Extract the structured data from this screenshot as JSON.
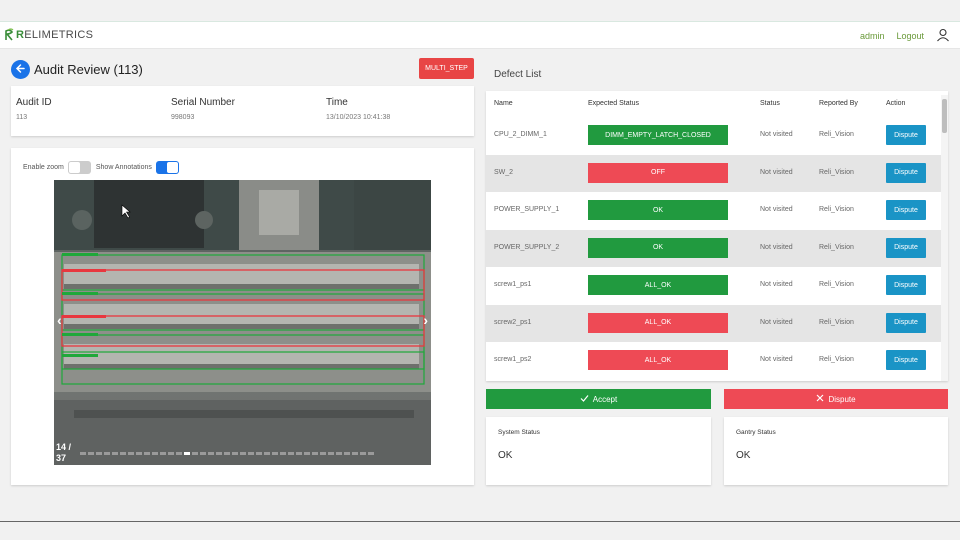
{
  "header": {
    "brand_initial": "R",
    "brand_rest": "ELIMETRICS",
    "user": "admin",
    "logout": "Logout"
  },
  "audit": {
    "title": "Audit Review (113)",
    "multi_step": "MULTI_STEP",
    "fields": [
      {
        "label": "Audit ID",
        "value": "113"
      },
      {
        "label": "Serial Number",
        "value": "998093"
      },
      {
        "label": "Time",
        "value": "13/10/2023 10:41:38"
      }
    ],
    "enable_zoom": "Enable zoom",
    "show_annotations": "Show Annotations",
    "zoom_enabled": false,
    "annotations_enabled": true,
    "counter_current": "14 /",
    "counter_total": "37",
    "current_index": 14,
    "total_images": 37
  },
  "defects": {
    "title": "Defect List",
    "columns": [
      "Name",
      "Expected Status",
      "Status",
      "Reported By",
      "Action"
    ],
    "rows": [
      {
        "name": "CPU_2_DIMM_1",
        "expected": "DIMM_EMPTY_LATCH_CLOSED",
        "expected_color": "#219a3f",
        "status": "Not visited",
        "reported_by": "Reli_Vision",
        "action": "Dispute"
      },
      {
        "name": "SW_2",
        "expected": "OFF",
        "expected_color": "#ee4a55",
        "status": "Not visited",
        "reported_by": "Reli_Vision",
        "action": "Dispute"
      },
      {
        "name": "POWER_SUPPLY_1",
        "expected": "OK",
        "expected_color": "#219a3f",
        "status": "Not visited",
        "reported_by": "Reli_Vision",
        "action": "Dispute"
      },
      {
        "name": "POWER_SUPPLY_2",
        "expected": "OK",
        "expected_color": "#219a3f",
        "status": "Not visited",
        "reported_by": "Reli_Vision",
        "action": "Dispute"
      },
      {
        "name": "screw1_ps1",
        "expected": "ALL_OK",
        "expected_color": "#219a3f",
        "status": "Not visited",
        "reported_by": "Reli_Vision",
        "action": "Dispute"
      },
      {
        "name": "screw2_ps1",
        "expected": "ALL_OK",
        "expected_color": "#ee4a55",
        "status": "Not visited",
        "reported_by": "Reli_Vision",
        "action": "Dispute"
      },
      {
        "name": "screw1_ps2",
        "expected": "ALL_OK",
        "expected_color": "#ee4a55",
        "status": "Not visited",
        "reported_by": "Reli_Vision",
        "action": "Dispute"
      }
    ],
    "accept": "Accept",
    "dispute": "Dispute"
  },
  "status": {
    "system_label": "System Status",
    "system_value": "OK",
    "gantry_label": "Gantry Status",
    "gantry_value": "OK"
  },
  "colors": {
    "primary": "#1a73e8",
    "success": "#219a3f",
    "danger": "#ee4a55",
    "action": "#1a94c6"
  },
  "icons": {
    "back": "arrow-left-icon",
    "user": "user-icon",
    "accept": "check-icon",
    "dispute": "close-icon",
    "prev": "chevron-left-icon",
    "next": "chevron-right-icon"
  }
}
